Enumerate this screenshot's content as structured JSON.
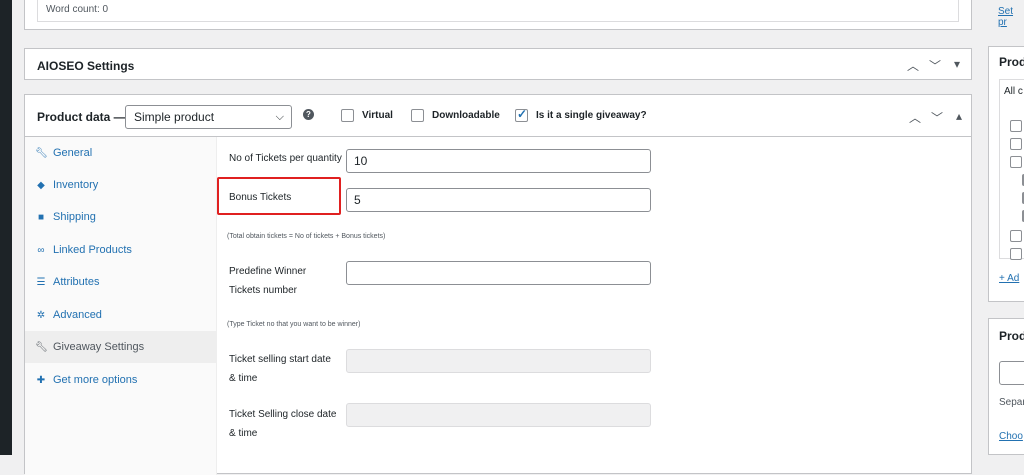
{
  "editor": {
    "word_count": "Word count: 0"
  },
  "aioseo": {
    "title": "AIOSEO Settings"
  },
  "product_data": {
    "title": "Product data —",
    "type_select": "Simple product",
    "checkboxes": [
      {
        "label": "Virtual",
        "checked": false
      },
      {
        "label": "Downloadable",
        "checked": false
      },
      {
        "label": "Is it a single giveaway?",
        "checked": true
      }
    ],
    "tabs": [
      {
        "label": "General",
        "icon": "wrench-icon"
      },
      {
        "label": "Inventory",
        "icon": "tag-icon"
      },
      {
        "label": "Shipping",
        "icon": "truck-icon"
      },
      {
        "label": "Linked Products",
        "icon": "link-icon"
      },
      {
        "label": "Attributes",
        "icon": "list-icon"
      },
      {
        "label": "Advanced",
        "icon": "gear-icon"
      },
      {
        "label": "Giveaway Settings",
        "icon": "wrench-icon",
        "active": true
      },
      {
        "label": "Get more options",
        "icon": "plugin-icon"
      }
    ],
    "fields": {
      "tickets_per_qty_label": "No of Tickets per quantity",
      "tickets_per_qty_value": "10",
      "bonus_label": "Bonus Tickets",
      "bonus_value": "5",
      "bonus_hint": "(Total obtain tickets = No of tickets + Bonus tickets)",
      "winner_label_1": "Predefine Winner",
      "winner_label_2": "Tickets number",
      "winner_value": "",
      "winner_hint": "(Type Ticket no that you want to be winner)",
      "start_label_1": "Ticket selling start date",
      "start_label_2": "& time",
      "close_label_1": "Ticket Selling close date",
      "close_label_2": "& time"
    }
  },
  "sidebar": {
    "top_link": "Set pr",
    "box1_title": "Prod",
    "box1_filter": "All c",
    "box1_add": "+ Ad",
    "box2_title": "Prod",
    "box2_sep": "Separ",
    "box2_choose": "Choo"
  }
}
